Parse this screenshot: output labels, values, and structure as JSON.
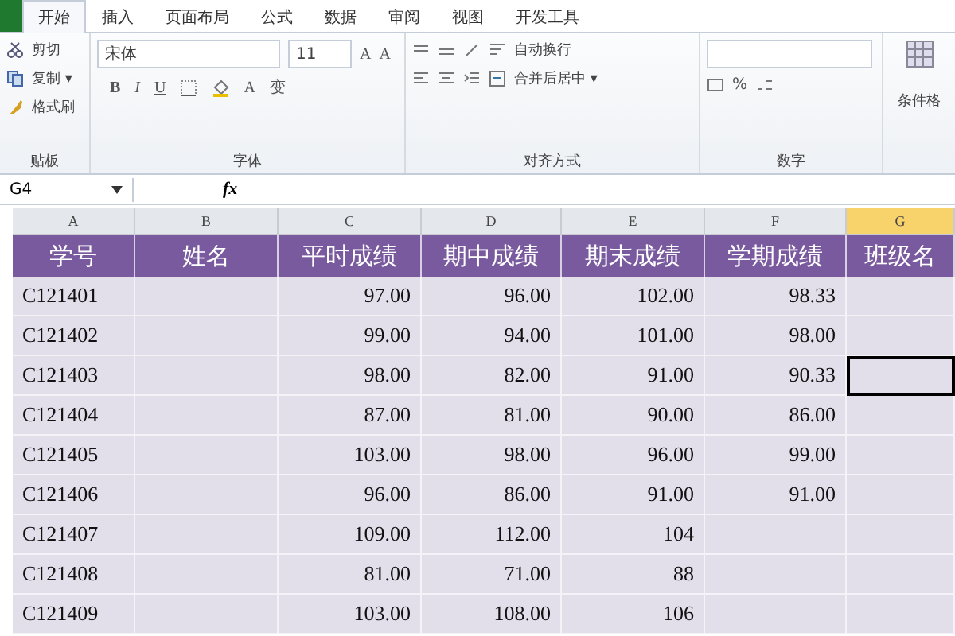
{
  "ribbon": {
    "tabs": [
      {
        "label": "开始",
        "selected": true
      },
      {
        "label": "插入",
        "selected": false
      },
      {
        "label": "页面布局",
        "selected": false
      },
      {
        "label": "公式",
        "selected": false
      },
      {
        "label": "数据",
        "selected": false
      },
      {
        "label": "审阅",
        "selected": false
      },
      {
        "label": "视图",
        "selected": false
      },
      {
        "label": "开发工具",
        "selected": false
      }
    ],
    "clipboard": {
      "items": [
        "剪切",
        "复制 ▾",
        "格式刷"
      ],
      "label": "贴板"
    },
    "font": {
      "name": "宋体",
      "size": "11",
      "grow": "A",
      "shrink": "A",
      "bold": "B",
      "italic": "I",
      "underline": "U",
      "font_color": "A",
      "phonetic": "变",
      "label": "字体"
    },
    "alignment": {
      "wrap": "自动换行",
      "merge": "合并后居中 ▾",
      "label": "对齐方式"
    },
    "number": {
      "percent": "%",
      "label": "数字"
    },
    "styles": {
      "conditional": "条件格"
    }
  },
  "formula_bar": {
    "name_box": "G4",
    "fx": "fx"
  },
  "table": {
    "columns": [
      {
        "letter": "A",
        "selected": false
      },
      {
        "letter": "B",
        "selected": false
      },
      {
        "letter": "C",
        "selected": false
      },
      {
        "letter": "D",
        "selected": false
      },
      {
        "letter": "E",
        "selected": false
      },
      {
        "letter": "F",
        "selected": false
      },
      {
        "letter": "G",
        "selected": true
      }
    ],
    "header": [
      "学号",
      "姓名",
      "平时成绩",
      "期中成绩",
      "期末成绩",
      "学期成绩",
      "班级名"
    ],
    "rows": [
      {
        "cells": [
          "C121401",
          "97.00",
          "96.00",
          "102.00",
          "98.33"
        ],
        "selected": false
      },
      {
        "cells": [
          "C121402",
          "99.00",
          "94.00",
          "101.00",
          "98.00"
        ],
        "selected": false
      },
      {
        "cells": [
          "C121403",
          "98.00",
          "82.00",
          "91.00",
          "90.33"
        ],
        "selected": true
      },
      {
        "cells": [
          "C121404",
          "87.00",
          "81.00",
          "90.00",
          "86.00"
        ],
        "selected": false
      },
      {
        "cells": [
          "C121405",
          "103.00",
          "98.00",
          "96.00",
          "99.00"
        ],
        "selected": false
      },
      {
        "cells": [
          "C121406",
          "96.00",
          "86.00",
          "91.00",
          "91.00"
        ],
        "selected": false
      },
      {
        "cells": [
          "C121407",
          "109.00",
          "112.00",
          "104"
        ],
        "selected": false
      },
      {
        "cells": [
          "C121408",
          "81.00",
          "71.00",
          "88"
        ],
        "selected": false
      },
      {
        "cells": [
          "C121409",
          "103.00",
          "108.00",
          "106"
        ],
        "selected": false
      }
    ]
  }
}
